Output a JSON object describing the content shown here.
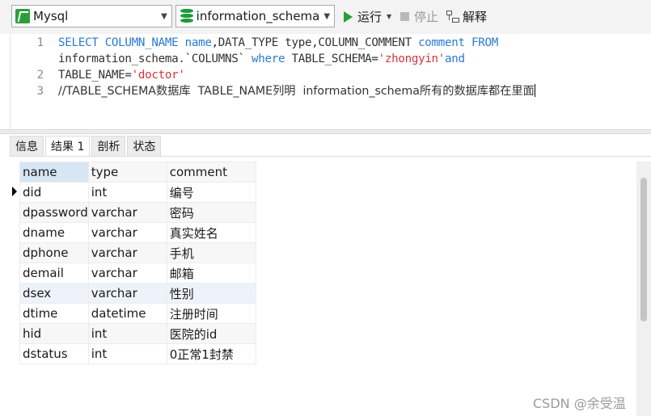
{
  "toolbar": {
    "connection": "Mysql",
    "database": "information_schema",
    "run_label": "运行",
    "stop_label": "停止",
    "explain_label": "解释"
  },
  "editor": {
    "line_numbers": [
      "1",
      "2",
      "3"
    ],
    "lines": {
      "l1a": [
        "SELECT COLUMN_NAME ",
        "name",
        ",DATA_TYPE type,COLUMN_COMMENT ",
        "comment",
        " ",
        "FROM"
      ],
      "l1b": [
        "information_schema.`COLUMNS` ",
        "where",
        " TABLE_SCHEMA=",
        "'zhongyin'",
        "and"
      ],
      "l2": [
        "TABLE_NAME=",
        "'doctor'"
      ],
      "l3": "//TABLE_SCHEMA数据库  TABLE_NAME列明  information_schema所有的数据库都在里面"
    }
  },
  "tabs": [
    "信息",
    "结果 1",
    "剖析",
    "状态"
  ],
  "active_tab": 1,
  "grid": {
    "columns": [
      "name",
      "type",
      "comment"
    ],
    "rows": [
      [
        "did",
        "int",
        "编号"
      ],
      [
        "dpassword",
        "varchar",
        "密码"
      ],
      [
        "dname",
        "varchar",
        "真实姓名"
      ],
      [
        "dphone",
        "varchar",
        "手机"
      ],
      [
        "demail",
        "varchar",
        "邮箱"
      ],
      [
        "dsex",
        "varchar",
        "性别"
      ],
      [
        "dtime",
        "datetime",
        "注册时间"
      ],
      [
        "hid",
        "int",
        "医院的id"
      ],
      [
        "dstatus",
        "int",
        "0正常1封禁"
      ]
    ]
  },
  "watermark": "CSDN @余受温",
  "colors": {
    "keyword": "#2a7ad3",
    "string": "#d6333a",
    "run": "#27a03b",
    "selected_header": "#d7e6f5"
  }
}
